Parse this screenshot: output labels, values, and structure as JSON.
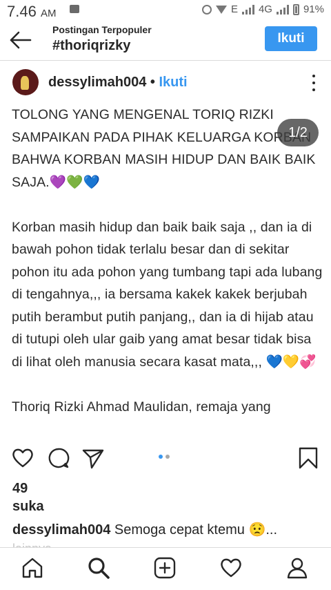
{
  "status_bar": {
    "time": "7.46",
    "ampm": "AM",
    "network_labels": [
      "E",
      "4G"
    ],
    "battery": "91%"
  },
  "header": {
    "subtitle": "Postingan Terpopuler",
    "title": "#thoriqrizky",
    "follow_label": "Ikuti",
    "accent_color": "#3897f0"
  },
  "post": {
    "username": "dessylimah004",
    "separator": "•",
    "follow_label": "Ikuti",
    "page_indicator": "1/2",
    "paragraphs": [
      "TOLONG YANG MENGENAL TORIQ RIZKI SAMPAIKAN PADA PIHAK KELUARGA KORBAN BAHWA KORBAN MASIH HIDUP DAN BAIK BAIK SAJA.💜💚💙",
      "Korban masih hidup dan baik baik saja ,, dan ia di bawah pohon tidak terlalu besar dan di sekitar pohon itu ada pohon yang tumbang tapi ada lubang di tengahnya,,, ia bersama kakek kakek berjubah putih berambut putih panjang,, dan ia di hijab atau di tutupi oleh ular gaib yang amat besar tidak bisa di lihat oleh manusia secara kasat mata,,, 💙💛💞",
      "Thoriq Rizki Ahmad Maulidan, remaja yang"
    ],
    "carousel_dots": 2,
    "carousel_active": 0
  },
  "engagement": {
    "likes_count": "49",
    "likes_label": "suka",
    "caption_user": "dessylimah004",
    "caption_text": "Semoga cepat ktemu 😟...",
    "caption_more": "lainnya"
  },
  "bottom_nav": {
    "items": [
      "home-icon",
      "search-icon",
      "add-icon",
      "heart-icon",
      "profile-icon"
    ]
  }
}
